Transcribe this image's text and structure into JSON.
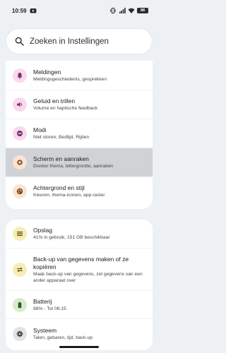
{
  "status_bar": {
    "time": "10:59",
    "battery": "88",
    "icons": [
      "youtube-icon",
      "vibrate-icon",
      "signal-icon",
      "wifi-icon",
      "battery-icon"
    ]
  },
  "search": {
    "placeholder": "Zoeken in Instellingen",
    "icon": "search-icon"
  },
  "group1": [
    {
      "title": "Meldingen",
      "subtitle": "Meldingsgeschiedenis, gesprekken",
      "icon": "bell-icon",
      "icon_bg": "#f8d9ef",
      "icon_color": "#7a2d63"
    },
    {
      "title": "Geluid en trillen",
      "subtitle": "Volume en haptische feedback",
      "icon": "volume-icon",
      "icon_bg": "#f8d9ef",
      "icon_color": "#7a2d63"
    },
    {
      "title": "Modi",
      "subtitle": "Niet storen, Bedtijd, Rijden",
      "icon": "do-not-disturb-icon",
      "icon_bg": "#f8d9ef",
      "icon_color": "#7a2d63"
    },
    {
      "title": "Scherm en aanraken",
      "subtitle": "Donker thema, lettergrootte, aanraken",
      "icon": "brightness-icon",
      "icon_bg": "#fbe3d1",
      "icon_color": "#7a4a1e"
    },
    {
      "title": "Achtergrond en stijl",
      "subtitle": "Kleuren, thema-iconen, app-raster",
      "icon": "palette-icon",
      "icon_bg": "#fbe3d1",
      "icon_color": "#7a4a1e"
    }
  ],
  "group2": [
    {
      "title": "Opslag",
      "subtitle": "41% in gebruik, 151 GB beschikbaar",
      "icon": "storage-icon",
      "icon_bg": "#f7ecb5",
      "icon_color": "#5f5210"
    },
    {
      "title": "Back-up van gegevens maken of ze kopiëren",
      "subtitle": "Maak back-up van gegevens, zet gegevens van een ander apparaat over",
      "icon": "transfer-icon",
      "icon_bg": "#f7ecb5",
      "icon_color": "#5f5210"
    },
    {
      "title": "Batterij",
      "subtitle": "88% - Tot 06:15",
      "icon": "battery-icon",
      "icon_bg": "#d7ecce",
      "icon_color": "#2f5a22"
    },
    {
      "title": "Systeem",
      "subtitle": "Talen, gebaren, tijd, back-up",
      "icon": "gear-icon",
      "icon_bg": "#e2e3e6",
      "icon_color": "#3c3f44"
    }
  ],
  "colors": {
    "background": "#eef1f4",
    "card": "#ffffff",
    "highlight": "#d0d2d6",
    "text_primary": "#1b1c1e",
    "text_secondary": "#44474d"
  }
}
